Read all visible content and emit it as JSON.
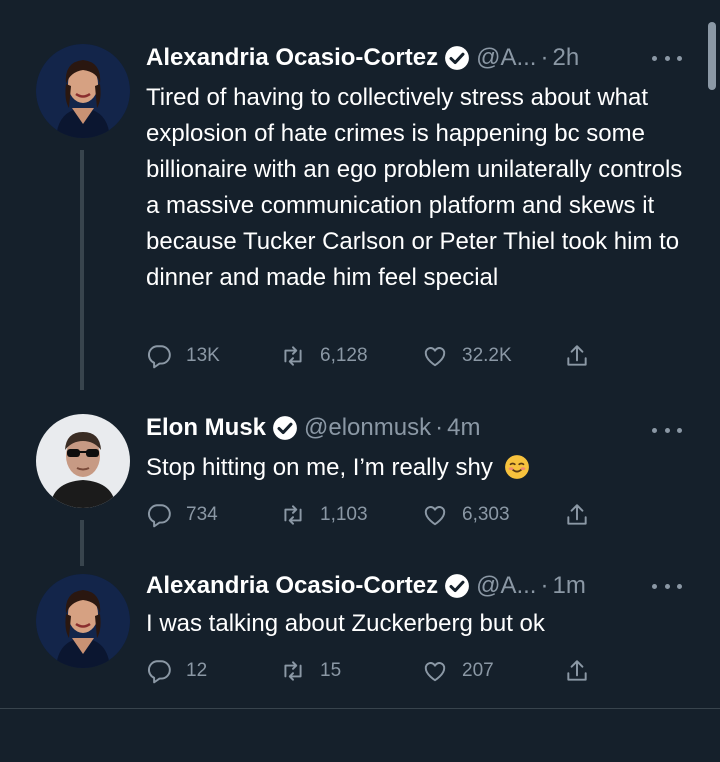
{
  "tweets": [
    {
      "name": "Alexandria Ocasio-Cortez",
      "handle": "@A...",
      "dot": "·",
      "time": "2h",
      "text": "Tired of having to collectively stress about what explosion of hate crimes is happening bc some billionaire with an ego problem unilaterally controls a massive communication platform and skews it because Tucker Carlson or Peter Thiel took him to dinner and made him feel special",
      "replies": "13K",
      "retweets": "6,128",
      "likes": "32.2K"
    },
    {
      "name": "Elon Musk",
      "handle": "@elonmusk",
      "dot": "·",
      "time": "4m",
      "text": "Stop hitting on me, I’m really shy",
      "emoji": "smiling-face-icon",
      "replies": "734",
      "retweets": "1,103",
      "likes": "6,303"
    },
    {
      "name": "Alexandria Ocasio-Cortez",
      "handle": "@A...",
      "dot": "·",
      "time": "1m",
      "text": "I was talking about Zuckerberg but ok",
      "replies": "12",
      "retweets": "15",
      "likes": "207"
    }
  ],
  "colors": {
    "background": "#15202b",
    "text": "#ffffff",
    "secondary": "#8b98a5",
    "verified": "#1d9bf0",
    "thread_line": "#38444d"
  },
  "icons": [
    "reply-icon",
    "retweet-icon",
    "like-icon",
    "share-icon",
    "verified-badge-icon",
    "more-icon"
  ]
}
